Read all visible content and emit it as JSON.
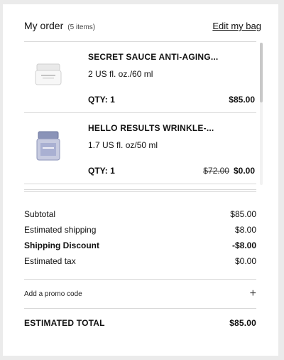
{
  "header": {
    "title": "My order",
    "count": "(5 items)",
    "edit_label": "Edit my bag"
  },
  "items": [
    {
      "name": "SECRET SAUCE ANTI-AGING...",
      "size": "2 US fl. oz./60 ml",
      "qty": "QTY: 1",
      "original_price": "",
      "price": "$85.00",
      "icon": "white-jar-icon"
    },
    {
      "name": "HELLO RESULTS WRINKLE-...",
      "size": "1.7 US fl. oz/50 ml",
      "qty": "QTY: 1",
      "original_price": "$72.00",
      "price": "$0.00",
      "icon": "blue-jar-icon"
    }
  ],
  "summary": {
    "subtotal_label": "Subtotal",
    "subtotal_value": "$85.00",
    "shipping_label": "Estimated shipping",
    "shipping_value": "$8.00",
    "discount_label": "Shipping Discount",
    "discount_value": "-$8.00",
    "tax_label": "Estimated tax",
    "tax_value": "$0.00"
  },
  "promo": {
    "label": "Add a promo code",
    "icon": "plus-icon",
    "glyph": "+"
  },
  "total": {
    "label": "ESTIMATED TOTAL",
    "value": "$85.00"
  }
}
